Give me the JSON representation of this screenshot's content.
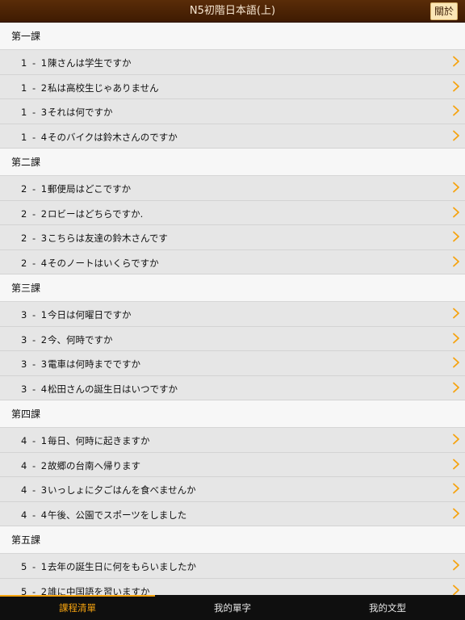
{
  "nav": {
    "title": "N5初階日本語(上)",
    "about_label": "關於"
  },
  "accent_color": "#f6a30f",
  "chevron_icon": "chevron-right-icon",
  "sections": [
    {
      "title": "第一課",
      "items": [
        {
          "num": "1 - 1",
          "title": "陳さんは学生ですか"
        },
        {
          "num": "1 - 2",
          "title": "私は高校生じゃありません"
        },
        {
          "num": "1 - 3",
          "title": "それは何ですか"
        },
        {
          "num": "1 - 4",
          "title": "そのバイクは鈴木さんのですか"
        }
      ]
    },
    {
      "title": "第二課",
      "items": [
        {
          "num": "2 - 1",
          "title": "郵便局はどこですか"
        },
        {
          "num": "2 - 2",
          "title": "ロビーはどちらですか."
        },
        {
          "num": "2 - 3",
          "title": "こちらは友達の鈴木さんです"
        },
        {
          "num": "2 - 4",
          "title": "そのノートはいくらですか"
        }
      ]
    },
    {
      "title": "第三課",
      "items": [
        {
          "num": "3 - 1",
          "title": "今日は何曜日ですか"
        },
        {
          "num": "3 - 2",
          "title": "今、何時ですか"
        },
        {
          "num": "3 - 3",
          "title": "電車は何時までですか"
        },
        {
          "num": "3 - 4",
          "title": "松田さんの誕生日はいつですか"
        }
      ]
    },
    {
      "title": "第四課",
      "items": [
        {
          "num": "4 - 1",
          "title": "毎日、何時に起きますか"
        },
        {
          "num": "4 - 2",
          "title": "故郷の台南へ帰ります"
        },
        {
          "num": "4 - 3",
          "title": "いっしょに夕ごはんを食べませんか"
        },
        {
          "num": "4 - 4",
          "title": "午後、公園でスポーツをしました"
        }
      ]
    },
    {
      "title": "第五課",
      "items": [
        {
          "num": "5 - 1",
          "title": "去年の誕生日に何をもらいましたか"
        },
        {
          "num": "5 - 2",
          "title": "誰に中国語を習いますか"
        }
      ]
    }
  ],
  "tabs": [
    {
      "label": "課程清單",
      "active": true
    },
    {
      "label": "我的單字",
      "active": false
    },
    {
      "label": "我的文型",
      "active": false
    }
  ]
}
